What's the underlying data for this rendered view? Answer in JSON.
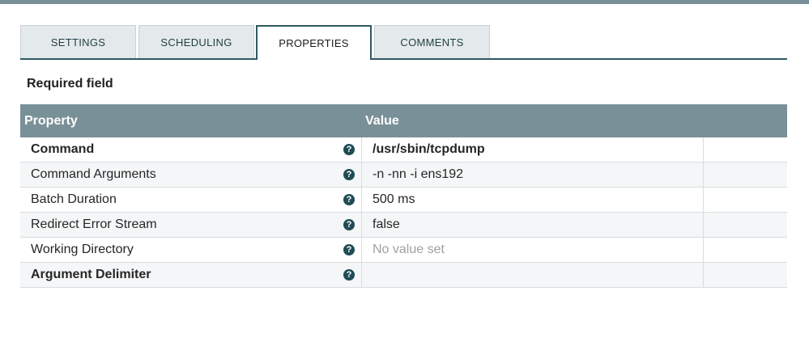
{
  "tabs": [
    {
      "label": "SETTINGS"
    },
    {
      "label": "SCHEDULING"
    },
    {
      "label": "PROPERTIES"
    },
    {
      "label": "COMMENTS"
    }
  ],
  "active_tab": "PROPERTIES",
  "required_field_label": "Required field",
  "table": {
    "headers": {
      "property": "Property",
      "value": "Value"
    },
    "rows": [
      {
        "name": "Command",
        "value": "/usr/sbin/tcpdump",
        "required": true
      },
      {
        "name": "Command Arguments",
        "value": "-n -nn -i ens192",
        "required": false
      },
      {
        "name": "Batch Duration",
        "value": "500 ms",
        "required": false
      },
      {
        "name": "Redirect Error Stream",
        "value": "false",
        "required": false
      },
      {
        "name": "Working Directory",
        "value": "No value set",
        "required": false,
        "unset": true
      },
      {
        "name": "Argument Delimiter",
        "value": "",
        "required": true
      }
    ]
  },
  "help_icon_glyph": "?",
  "colors": {
    "header_bg": "#7a9098",
    "accent": "#2f5963",
    "help_icon": "#1f4c55"
  }
}
